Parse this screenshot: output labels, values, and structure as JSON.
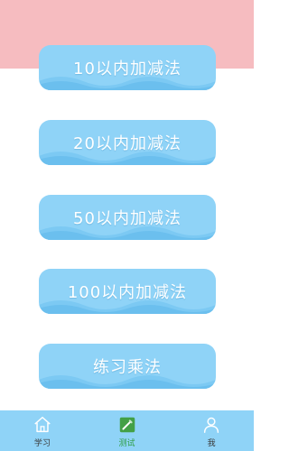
{
  "menu": {
    "items": [
      {
        "label": "10以内加减法"
      },
      {
        "label": "20以内加减法"
      },
      {
        "label": "50以内加减法"
      },
      {
        "label": "100以内加减法"
      },
      {
        "label": "练习乘法"
      }
    ]
  },
  "tabbar": {
    "tabs": [
      {
        "label": "学习",
        "icon": "home-icon"
      },
      {
        "label": "测试",
        "icon": "pencil-notebook-icon",
        "active": true
      },
      {
        "label": "我",
        "icon": "person-icon"
      }
    ]
  },
  "colors": {
    "top_band": "#f6bcc0",
    "button": "#8fd3f7",
    "tabbar": "#8fd3f7",
    "active_tab": "#2f9e44"
  }
}
